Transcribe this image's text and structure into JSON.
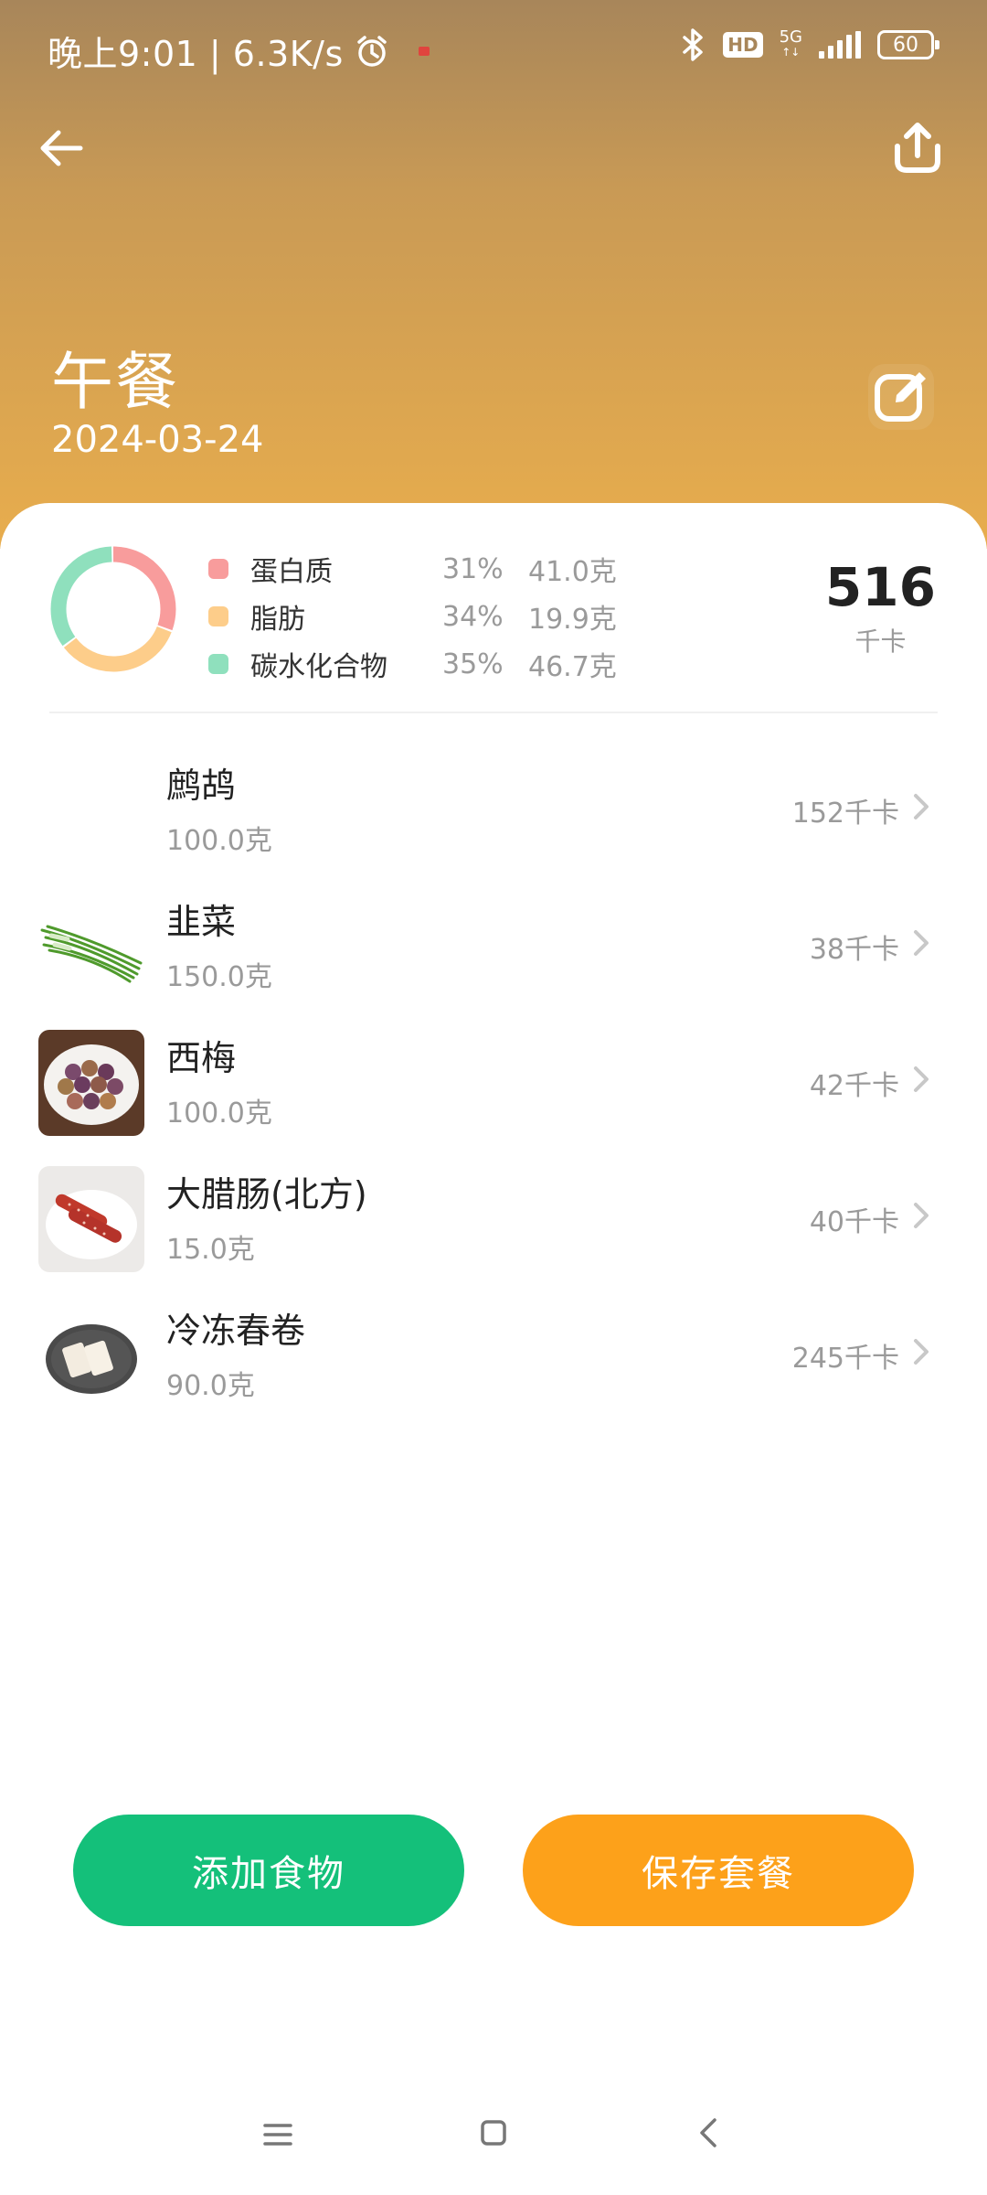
{
  "status_bar": {
    "time_speed": "晚上9:01 | 6.3K/s",
    "hd": "HD",
    "network": "5G",
    "battery": "60"
  },
  "header": {
    "meal_title": "午餐",
    "date": "2024-03-24"
  },
  "nutrition": {
    "items": [
      {
        "name": "蛋白质",
        "percent": "31%",
        "amount": "41.0克",
        "color": "#f89c9c",
        "fraction": 0.31
      },
      {
        "name": "脂肪",
        "percent": "34%",
        "amount": "19.9克",
        "color": "#fdcd8a",
        "fraction": 0.34
      },
      {
        "name": "碳水化合物",
        "percent": "35%",
        "amount": "46.7克",
        "color": "#8fe0bd",
        "fraction": 0.35
      }
    ],
    "total_calories": "516",
    "calorie_unit": "千卡"
  },
  "foods": [
    {
      "name": "鹧鸪",
      "amount": "100.0克",
      "calories": "152千卡",
      "icon": "none"
    },
    {
      "name": "韭菜",
      "amount": "150.0克",
      "calories": "38千卡",
      "icon": "chives-image"
    },
    {
      "name": "西梅",
      "amount": "100.0克",
      "calories": "42千卡",
      "icon": "prunes-image"
    },
    {
      "name": "大腊肠(北方)",
      "amount": "15.0克",
      "calories": "40千卡",
      "icon": "sausage-image"
    },
    {
      "name": "冷冻春卷",
      "amount": "90.0克",
      "calories": "245千卡",
      "icon": "spring-roll-image"
    }
  ],
  "actions": {
    "add_label": "添加食物",
    "save_label": "保存套餐"
  }
}
